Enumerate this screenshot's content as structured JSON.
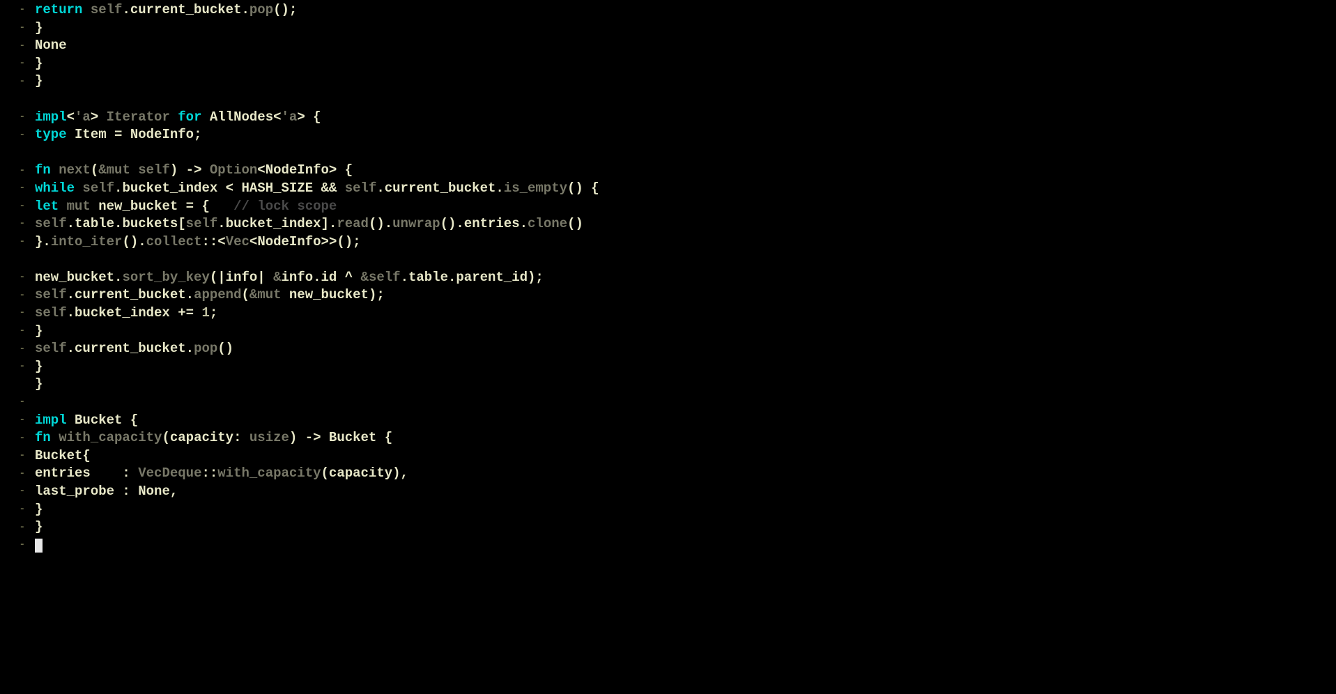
{
  "language": "rust",
  "theme": {
    "background": "#000000",
    "foreground": "#d8d8c0",
    "keyword": "#00d8d8",
    "dim": "#787868",
    "comment": "#4a4a4a"
  },
  "gutter_marks": [
    "dash",
    "dash",
    "dash",
    "dash",
    "dash",
    "space",
    "dash",
    "dash",
    "space",
    "dash",
    "dash",
    "dash",
    "dash",
    "dash",
    "space",
    "dash",
    "dash",
    "dash",
    "dash",
    "dash",
    "dash",
    "space",
    "dash",
    "dash",
    "dash",
    "dash",
    "dash",
    "dash",
    "dash",
    "dash"
  ],
  "code_lines": [
    {
      "indent": 16,
      "tokens": [
        [
          "kw",
          "return"
        ],
        [
          "op",
          " "
        ],
        [
          "dim",
          "self"
        ],
        [
          "op",
          "."
        ],
        [
          "ident",
          "current_bucket"
        ],
        [
          "op",
          "."
        ],
        [
          "dim",
          "pop"
        ],
        [
          "op",
          "();"
        ]
      ]
    },
    {
      "indent": 12,
      "tokens": [
        [
          "op",
          "}"
        ]
      ]
    },
    {
      "indent": 12,
      "tokens": [
        [
          "none",
          "None"
        ]
      ]
    },
    {
      "indent": 8,
      "tokens": [
        [
          "op",
          "}"
        ]
      ]
    },
    {
      "indent": 4,
      "tokens": [
        [
          "op",
          "}"
        ]
      ]
    },
    {
      "indent": 0,
      "tokens": []
    },
    {
      "indent": 4,
      "tokens": [
        [
          "kw",
          "impl"
        ],
        [
          "op",
          "<"
        ],
        [
          "dim",
          "'a"
        ],
        [
          "op",
          "> "
        ],
        [
          "dim",
          "Iterator"
        ],
        [
          "op",
          " "
        ],
        [
          "kw",
          "for"
        ],
        [
          "op",
          " "
        ],
        [
          "ty",
          "AllNodes"
        ],
        [
          "op",
          "<"
        ],
        [
          "dim",
          "'a"
        ],
        [
          "op",
          "> {"
        ]
      ]
    },
    {
      "indent": 8,
      "tokens": [
        [
          "kw",
          "type"
        ],
        [
          "op",
          " "
        ],
        [
          "ty",
          "Item"
        ],
        [
          "op",
          " = "
        ],
        [
          "ty",
          "NodeInfo"
        ],
        [
          "op",
          ";"
        ]
      ]
    },
    {
      "indent": 0,
      "tokens": []
    },
    {
      "indent": 8,
      "tokens": [
        [
          "kw",
          "fn"
        ],
        [
          "op",
          " "
        ],
        [
          "dim",
          "next"
        ],
        [
          "op",
          "("
        ],
        [
          "dim",
          "&mut self"
        ],
        [
          "op",
          ") -> "
        ],
        [
          "dim",
          "Option"
        ],
        [
          "op",
          "<"
        ],
        [
          "ty",
          "NodeInfo"
        ],
        [
          "op",
          "> {"
        ]
      ]
    },
    {
      "indent": 12,
      "tokens": [
        [
          "kw",
          "while"
        ],
        [
          "op",
          " "
        ],
        [
          "dim",
          "self"
        ],
        [
          "op",
          "."
        ],
        [
          "ident",
          "bucket_index"
        ],
        [
          "op",
          " < "
        ],
        [
          "const",
          "HASH_SIZE"
        ],
        [
          "op",
          " "
        ],
        [
          "ident",
          "&&"
        ],
        [
          "op",
          " "
        ],
        [
          "dim",
          "self"
        ],
        [
          "op",
          "."
        ],
        [
          "ident",
          "current_bucket"
        ],
        [
          "op",
          "."
        ],
        [
          "dim",
          "is_empty"
        ],
        [
          "op",
          "() {"
        ]
      ]
    },
    {
      "indent": 16,
      "tokens": [
        [
          "kw",
          "let"
        ],
        [
          "op",
          " "
        ],
        [
          "dim",
          "mut"
        ],
        [
          "op",
          " "
        ],
        [
          "ident",
          "new_bucket"
        ],
        [
          "op",
          " = {   "
        ],
        [
          "comment",
          "// lock scope"
        ]
      ]
    },
    {
      "indent": 20,
      "tokens": [
        [
          "dim",
          "self"
        ],
        [
          "op",
          "."
        ],
        [
          "ident",
          "table"
        ],
        [
          "op",
          "."
        ],
        [
          "ident",
          "buckets"
        ],
        [
          "op",
          "["
        ],
        [
          "dim",
          "self"
        ],
        [
          "op",
          "."
        ],
        [
          "ident",
          "bucket_index"
        ],
        [
          "op",
          "]."
        ],
        [
          "dim",
          "read"
        ],
        [
          "op",
          "()."
        ],
        [
          "dim",
          "unwrap"
        ],
        [
          "op",
          "()."
        ],
        [
          "ident",
          "entries"
        ],
        [
          "op",
          "."
        ],
        [
          "dim",
          "clone"
        ],
        [
          "op",
          "()"
        ]
      ]
    },
    {
      "indent": 16,
      "tokens": [
        [
          "op",
          "}."
        ],
        [
          "dim",
          "into_iter"
        ],
        [
          "op",
          "()."
        ],
        [
          "dim",
          "collect"
        ],
        [
          "op",
          "::<"
        ],
        [
          "dim",
          "Vec"
        ],
        [
          "op",
          "<"
        ],
        [
          "ty",
          "NodeInfo"
        ],
        [
          "op",
          ">>();"
        ]
      ]
    },
    {
      "indent": 0,
      "tokens": []
    },
    {
      "indent": 16,
      "tokens": [
        [
          "ident",
          "new_bucket"
        ],
        [
          "op",
          "."
        ],
        [
          "dim",
          "sort_by_key"
        ],
        [
          "op",
          "(|"
        ],
        [
          "ident",
          "info"
        ],
        [
          "op",
          "| "
        ],
        [
          "dim",
          "&"
        ],
        [
          "ident",
          "info"
        ],
        [
          "op",
          "."
        ],
        [
          "ident",
          "id"
        ],
        [
          "op",
          " ^ "
        ],
        [
          "dim",
          "&self"
        ],
        [
          "op",
          "."
        ],
        [
          "ident",
          "table"
        ],
        [
          "op",
          "."
        ],
        [
          "ident",
          "parent_id"
        ],
        [
          "op",
          ");"
        ]
      ]
    },
    {
      "indent": 16,
      "tokens": [
        [
          "dim",
          "self"
        ],
        [
          "op",
          "."
        ],
        [
          "ident",
          "current_bucket"
        ],
        [
          "op",
          "."
        ],
        [
          "dim",
          "append"
        ],
        [
          "op",
          "("
        ],
        [
          "dim",
          "&mut"
        ],
        [
          "op",
          " "
        ],
        [
          "ident",
          "new_bucket"
        ],
        [
          "op",
          ");"
        ]
      ]
    },
    {
      "indent": 16,
      "tokens": [
        [
          "dim",
          "self"
        ],
        [
          "op",
          "."
        ],
        [
          "ident",
          "bucket_index"
        ],
        [
          "op",
          " += "
        ],
        [
          "num",
          "1"
        ],
        [
          "op",
          ";"
        ]
      ]
    },
    {
      "indent": 12,
      "tokens": [
        [
          "op",
          "}"
        ]
      ]
    },
    {
      "indent": 12,
      "tokens": [
        [
          "dim",
          "self"
        ],
        [
          "op",
          "."
        ],
        [
          "ident",
          "current_bucket"
        ],
        [
          "op",
          "."
        ],
        [
          "dim",
          "pop"
        ],
        [
          "op",
          "()"
        ]
      ]
    },
    {
      "indent": 8,
      "tokens": [
        [
          "op",
          "}"
        ]
      ]
    },
    {
      "indent": 4,
      "tokens": [
        [
          "op",
          "}"
        ]
      ]
    },
    {
      "indent": 0,
      "tokens": []
    },
    {
      "indent": 4,
      "tokens": [
        [
          "kw",
          "impl"
        ],
        [
          "op",
          " "
        ],
        [
          "ty",
          "Bucket"
        ],
        [
          "op",
          " {"
        ]
      ]
    },
    {
      "indent": 8,
      "tokens": [
        [
          "kw",
          "fn"
        ],
        [
          "op",
          " "
        ],
        [
          "dim",
          "with_capacity"
        ],
        [
          "op",
          "("
        ],
        [
          "ident",
          "capacity"
        ],
        [
          "op",
          ": "
        ],
        [
          "dim",
          "usize"
        ],
        [
          "op",
          ") -> "
        ],
        [
          "ty",
          "Bucket"
        ],
        [
          "op",
          " {"
        ]
      ]
    },
    {
      "indent": 12,
      "tokens": [
        [
          "ty",
          "Bucket"
        ],
        [
          "op",
          "{"
        ]
      ]
    },
    {
      "indent": 16,
      "tokens": [
        [
          "ident",
          "entries"
        ],
        [
          "op",
          "    : "
        ],
        [
          "dim",
          "VecDeque"
        ],
        [
          "op",
          "::"
        ],
        [
          "dim",
          "with_capacity"
        ],
        [
          "op",
          "("
        ],
        [
          "ident",
          "capacity"
        ],
        [
          "op",
          "),"
        ]
      ]
    },
    {
      "indent": 16,
      "tokens": [
        [
          "ident",
          "last_probe"
        ],
        [
          "op",
          " : "
        ],
        [
          "none",
          "None"
        ],
        [
          "op",
          ","
        ]
      ]
    },
    {
      "indent": 12,
      "tokens": [
        [
          "op",
          "}"
        ]
      ]
    },
    {
      "indent": 8,
      "tokens": [
        [
          "op",
          "}"
        ]
      ]
    },
    {
      "indent": 0,
      "tokens": [],
      "cursor": true
    }
  ]
}
